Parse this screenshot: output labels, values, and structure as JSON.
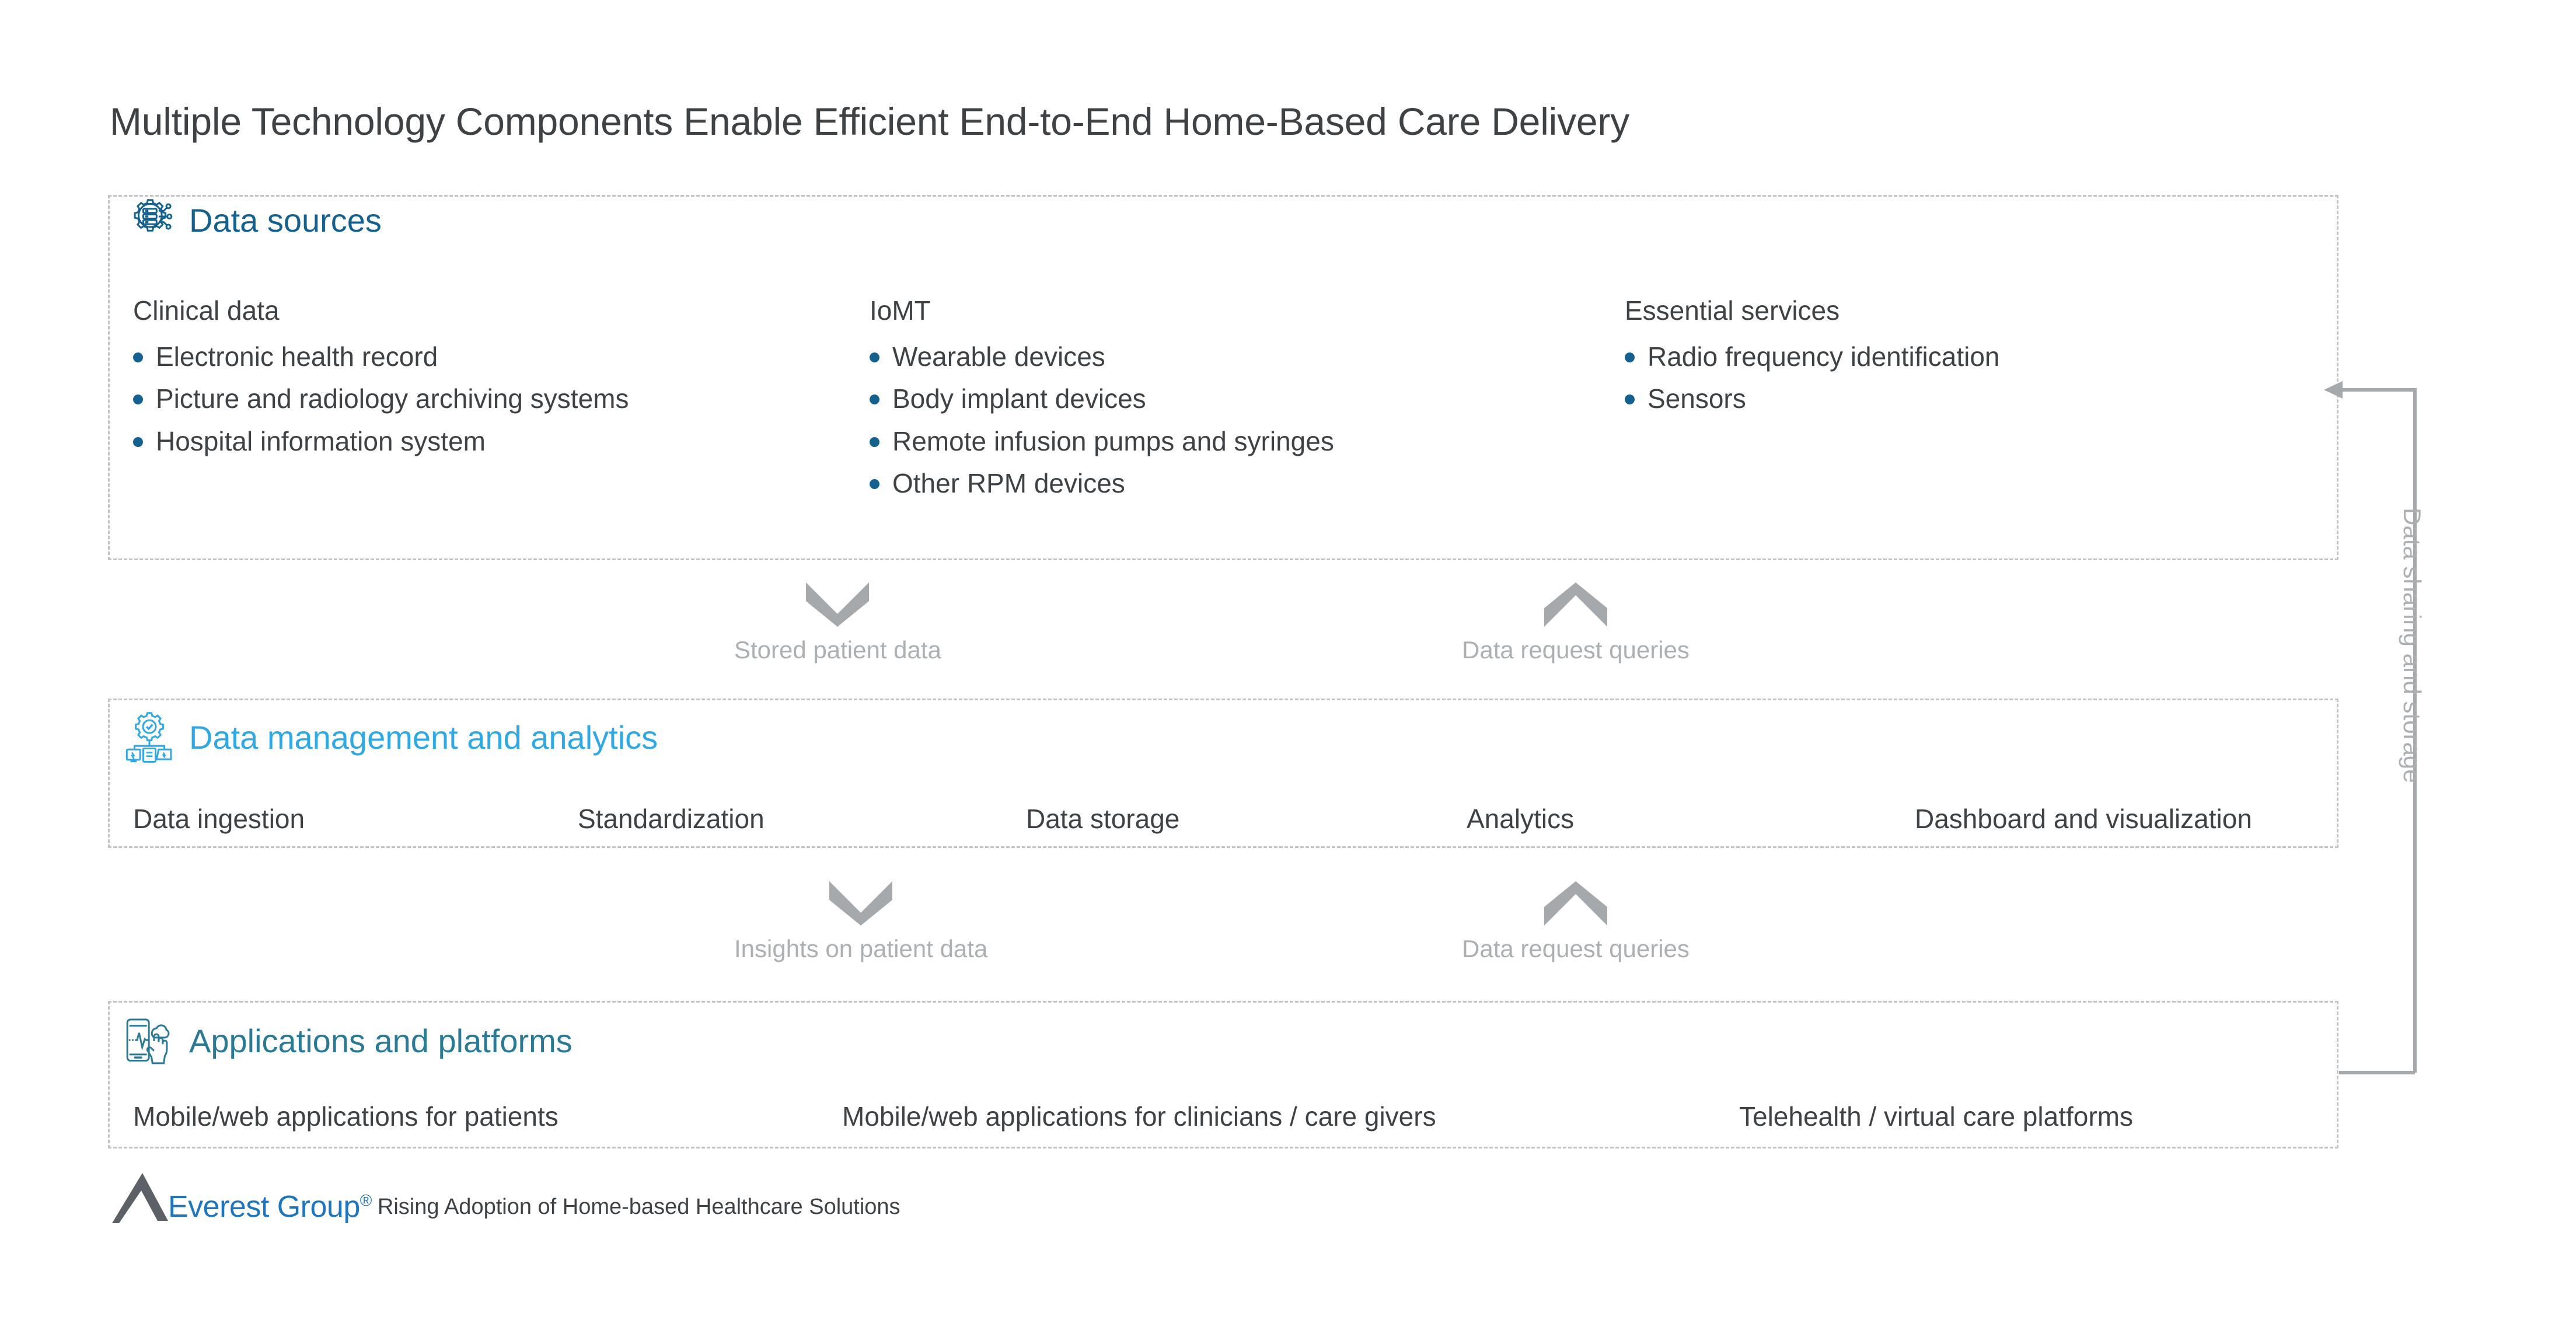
{
  "page_title": "Multiple Technology Components Enable Efficient End-to-End Home-Based Care Delivery",
  "sections": {
    "data_sources": {
      "title": "Data sources",
      "icon": "gear-database-circuit-icon",
      "color": "#14618f",
      "columns": [
        {
          "title": "Clinical data",
          "items": [
            "Electronic health record",
            "Picture and radiology archiving systems",
            "Hospital information system"
          ]
        },
        {
          "title": "IoMT",
          "items": [
            "Wearable devices",
            "Body implant devices",
            "Remote infusion pumps and syringes",
            "Other RPM devices"
          ]
        },
        {
          "title": "Essential services",
          "items": [
            "Radio frequency identification",
            "Sensors"
          ]
        }
      ]
    },
    "data_management": {
      "title": "Data management and analytics",
      "icon": "gear-check-devices-icon",
      "color": "#2fa8e4",
      "items": [
        "Data ingestion",
        "Standardization",
        "Data storage",
        "Analytics",
        "Dashboard and visualization"
      ]
    },
    "applications": {
      "title": "Applications and platforms",
      "icon": "mobile-vitals-touch-icon",
      "color": "#2a7a96",
      "items": [
        "Mobile/web applications for patients",
        "Mobile/web applications for clinicians / care givers",
        "Telehealth / virtual care platforms"
      ]
    }
  },
  "flows": {
    "stored_patient_data": {
      "label": "Stored patient data",
      "direction": "down"
    },
    "data_request_queries_top": {
      "label": "Data request queries",
      "direction": "up"
    },
    "insights_on_patient_data": {
      "label": "Insights on patient data",
      "direction": "down"
    },
    "data_request_queries_bottom": {
      "label": "Data request queries",
      "direction": "up"
    },
    "data_sharing_and_storage": {
      "label": "Data sharing and storage",
      "direction": "up-left"
    }
  },
  "footer": {
    "logo_text": "Everest Group",
    "logo_registered": "®",
    "note": "Rising Adoption of Home-based Healthcare Solutions"
  },
  "colors": {
    "text": "#3f4245",
    "muted": "#adb0b2",
    "dashed_border": "#c2c5c7",
    "bullet": "#14618f",
    "logo_blue": "#1f76bd",
    "logo_gray": "#5b6167"
  }
}
